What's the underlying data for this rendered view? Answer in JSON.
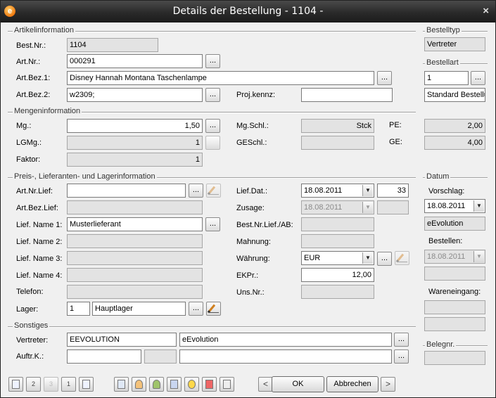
{
  "window": {
    "title": "Details der Bestellung - 1104 -",
    "close_glyph": "×",
    "icon_glyph": "e"
  },
  "sections": {
    "artikel": "Artikelinformation",
    "menge": "Mengeninformation",
    "preis": "Preis-, Lieferanten- und Lagerinformation",
    "sonstiges": "Sonstiges",
    "bestelltyp": "Bestelltyp",
    "bestellart": "Bestellart",
    "datum": "Datum",
    "belegnr": "Belegnr."
  },
  "artikel": {
    "best_nr_label": "Best.Nr.:",
    "best_nr": "1104",
    "art_nr_label": "Art.Nr.:",
    "art_nr": "000291",
    "art_bez1_label": "Art.Bez.1:",
    "art_bez1": "Disney Hannah Montana Taschenlampe",
    "art_bez2_label": "Art.Bez.2:",
    "art_bez2": "w2309;",
    "proj_label": "Proj.kennz:",
    "proj": ""
  },
  "menge": {
    "mg_label": "Mg.:",
    "mg": "1,50",
    "lgmg_label": "LGMg.:",
    "lgmg": "1",
    "faktor_label": "Faktor:",
    "faktor": "1",
    "mgschl_label": "Mg.Schl.:",
    "mgschl": "Stck",
    "geschl_label": "GESchl.:",
    "geschl": "",
    "pe_label": "PE:",
    "pe": "2,00",
    "ge_label": "GE:",
    "ge": "4,00"
  },
  "preis": {
    "art_nr_lief_label": "Art.Nr.Lief:",
    "art_nr_lief": "",
    "art_bez_lief_label": "Art.Bez.Lief:",
    "art_bez_lief": "",
    "lief_name1_label": "Lief. Name 1:",
    "lief_name1": "Musterlieferant",
    "lief_name2_label": "Lief. Name 2:",
    "lief_name2": "",
    "lief_name3_label": "Lief. Name 3:",
    "lief_name3": "",
    "lief_name4_label": "Lief. Name 4:",
    "lief_name4": "",
    "telefon_label": "Telefon:",
    "telefon": "",
    "lager_label": "Lager:",
    "lager_nr": "1",
    "lager_name": "Hauptlager",
    "lief_dat_label": "Lief.Dat.:",
    "lief_dat": "18.08.2011",
    "lief_kw": "33",
    "zusage_label": "Zusage:",
    "zusage": "18.08.2011",
    "zusage_kw": "",
    "best_nr_lief_label": "Best.Nr.Lief./AB:",
    "best_nr_lief": "",
    "mahnung_label": "Mahnung:",
    "mahnung": "",
    "waehrung_label": "Währung:",
    "waehrung": "EUR",
    "ekpr_label": "EKPr.:",
    "ekpr": "12,00",
    "uns_nr_label": "Uns.Nr.:",
    "uns_nr": ""
  },
  "sonstiges": {
    "vertreter_label": "Vertreter:",
    "vertreter_code": "EEVOLUTION",
    "vertreter_name": "eEvolution",
    "auftrk_label": "Auftr.K.:",
    "auftrk_a": "",
    "auftrk_b": "",
    "auftrk_c": ""
  },
  "right": {
    "bestelltyp": "Vertreter",
    "bestellart_nr": "1",
    "bestellart_name": "Standard Bestellung",
    "vorschlag_label": "Vorschlag:",
    "vorschlag": "18.08.2011",
    "vorschlag_user": "eEvolution",
    "bestellen_label": "Bestellen:",
    "bestellen": "18.08.2011",
    "bestellen_user": "",
    "wareneingang_label": "Wareneingang:",
    "wareneingang_a": "",
    "wareneingang_b": "",
    "belegnr": ""
  },
  "ellipsis": "...",
  "dropdown_glyph": "▼",
  "footer": {
    "nav_numbers": [
      "1",
      "2",
      "3",
      "1"
    ],
    "prev_glyph": "<",
    "next_glyph": ">",
    "ok_label": "OK",
    "cancel_label": "Abbrechen"
  }
}
